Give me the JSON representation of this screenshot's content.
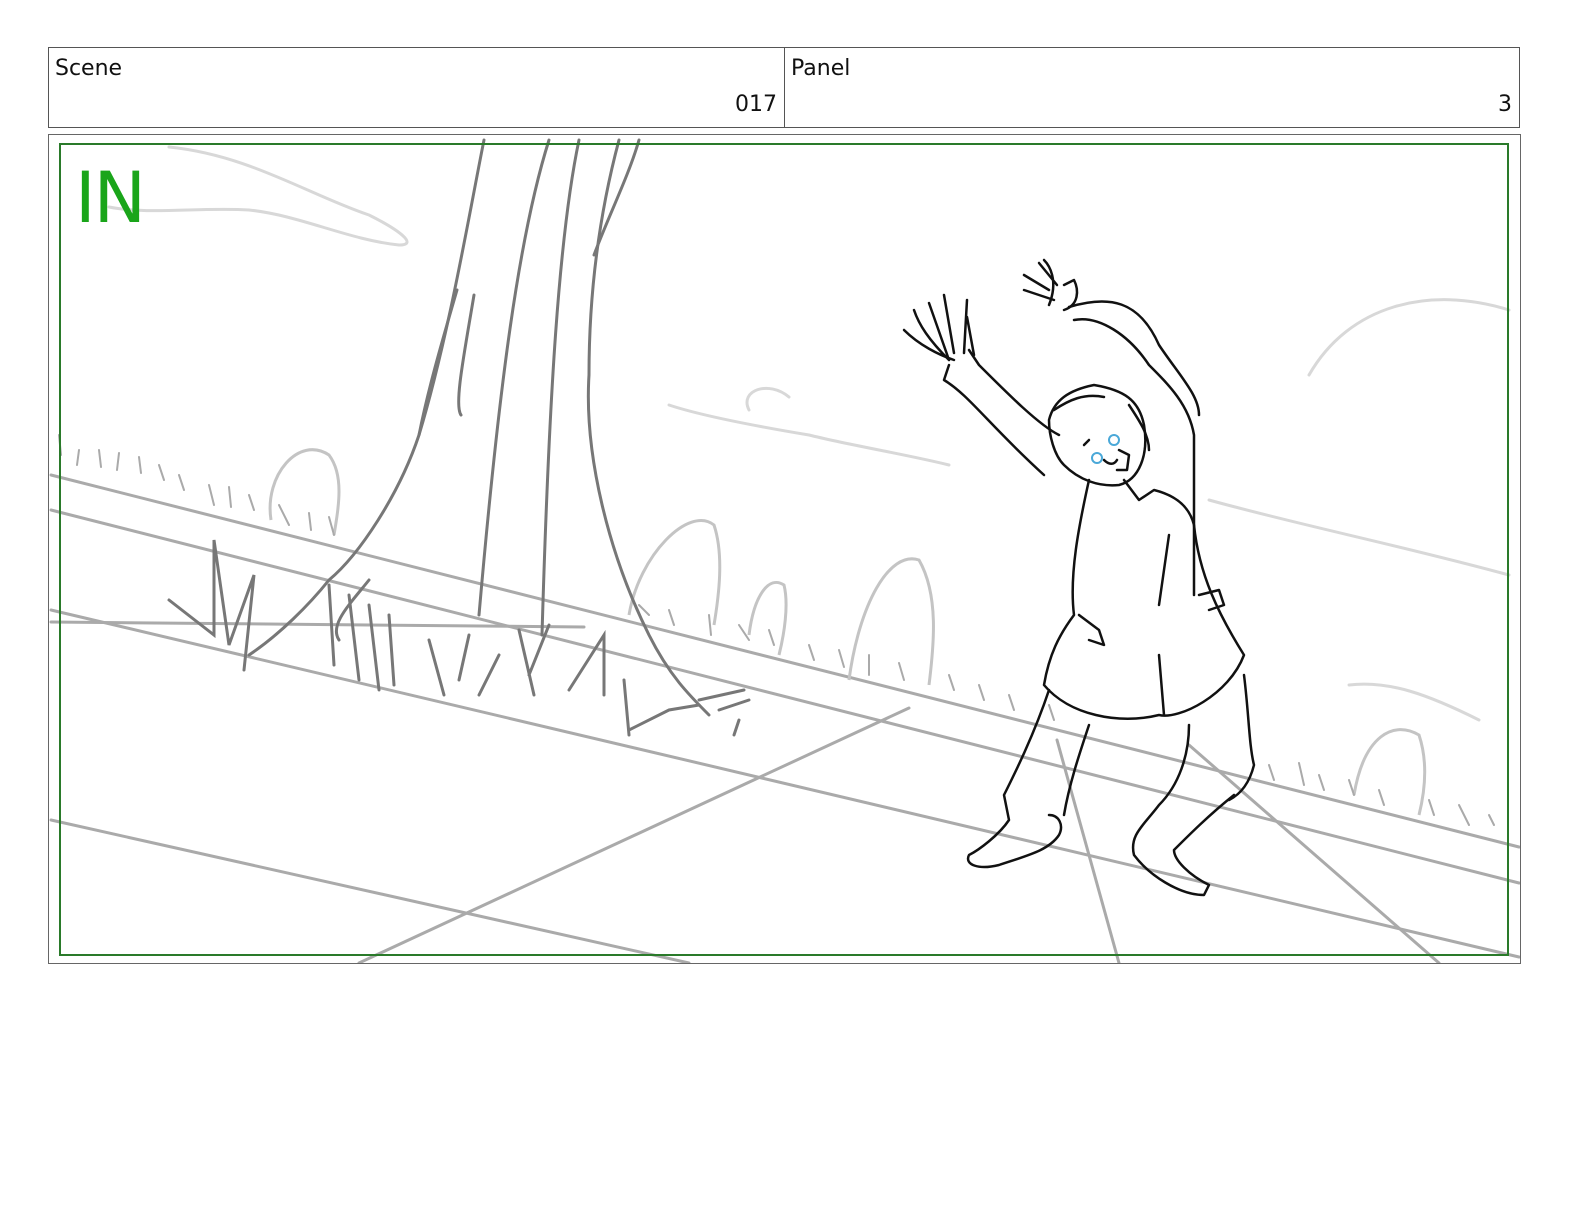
{
  "header": {
    "scene_label": "Scene",
    "scene_value": "017",
    "panel_label": "Panel",
    "panel_value": "3"
  },
  "panel": {
    "transition_tag": "IN",
    "tag_color": "#1aa51a",
    "safe_area_color": "#2a7a2a",
    "sketch_color": "#999999",
    "character_color": "#111111"
  }
}
